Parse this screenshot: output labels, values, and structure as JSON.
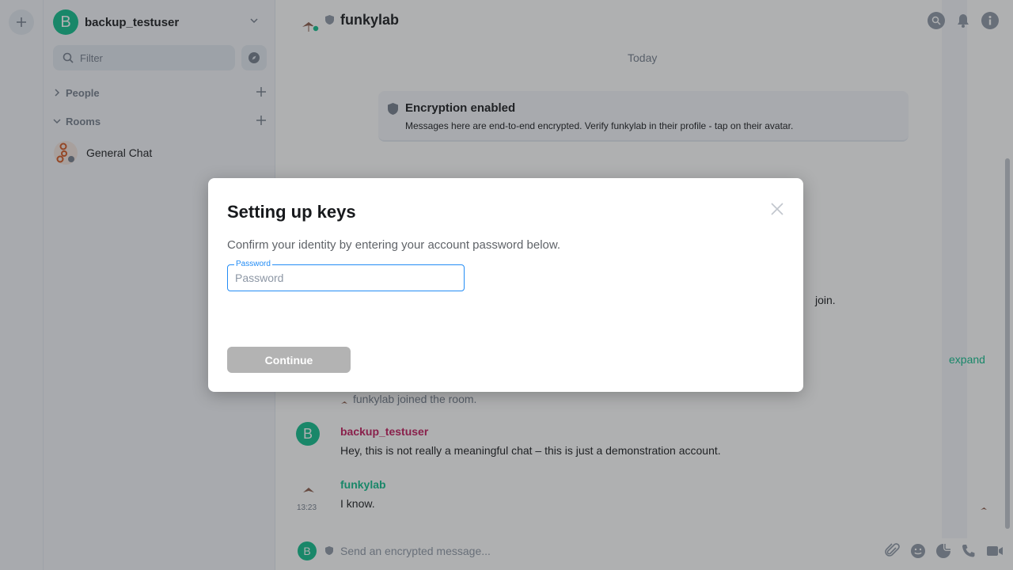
{
  "spaces": {
    "add_icon": "plus-icon"
  },
  "sidebar": {
    "user_initial": "B",
    "username": "backup_testuser",
    "filter_placeholder": "Filter",
    "sections": [
      {
        "label": "People"
      },
      {
        "label": "Rooms"
      }
    ],
    "rooms": [
      {
        "name": "General Chat"
      }
    ]
  },
  "room": {
    "title": "funkylab",
    "date_separator": "Today",
    "encryption": {
      "title": "Encryption enabled",
      "text": "Messages here are end-to-end encrypted. Verify funkylab in their profile - tap on their avatar."
    },
    "partial_text": "join.",
    "expand_label": "expand",
    "joined_text": "funkylab joined the room.",
    "messages": [
      {
        "initial": "B",
        "sender": "backup_testuser",
        "body": "Hey, this is not really a meaningful chat – this is just a demonstration account.",
        "color": "#c2185b"
      },
      {
        "sender": "funkylab",
        "time": "13:23",
        "body": "I know.",
        "color": "#0dbd8b"
      }
    ],
    "composer_initial": "B",
    "composer_placeholder": "Send an encrypted message..."
  },
  "dialog": {
    "title": "Setting up keys",
    "description": "Confirm your identity by entering your account password below.",
    "password_label": "Password",
    "password_placeholder": "Password",
    "continue_label": "Continue"
  },
  "colors": {
    "accent": "#0dbd8b",
    "focus": "#238cf5",
    "sender_user": "#c2185b"
  }
}
